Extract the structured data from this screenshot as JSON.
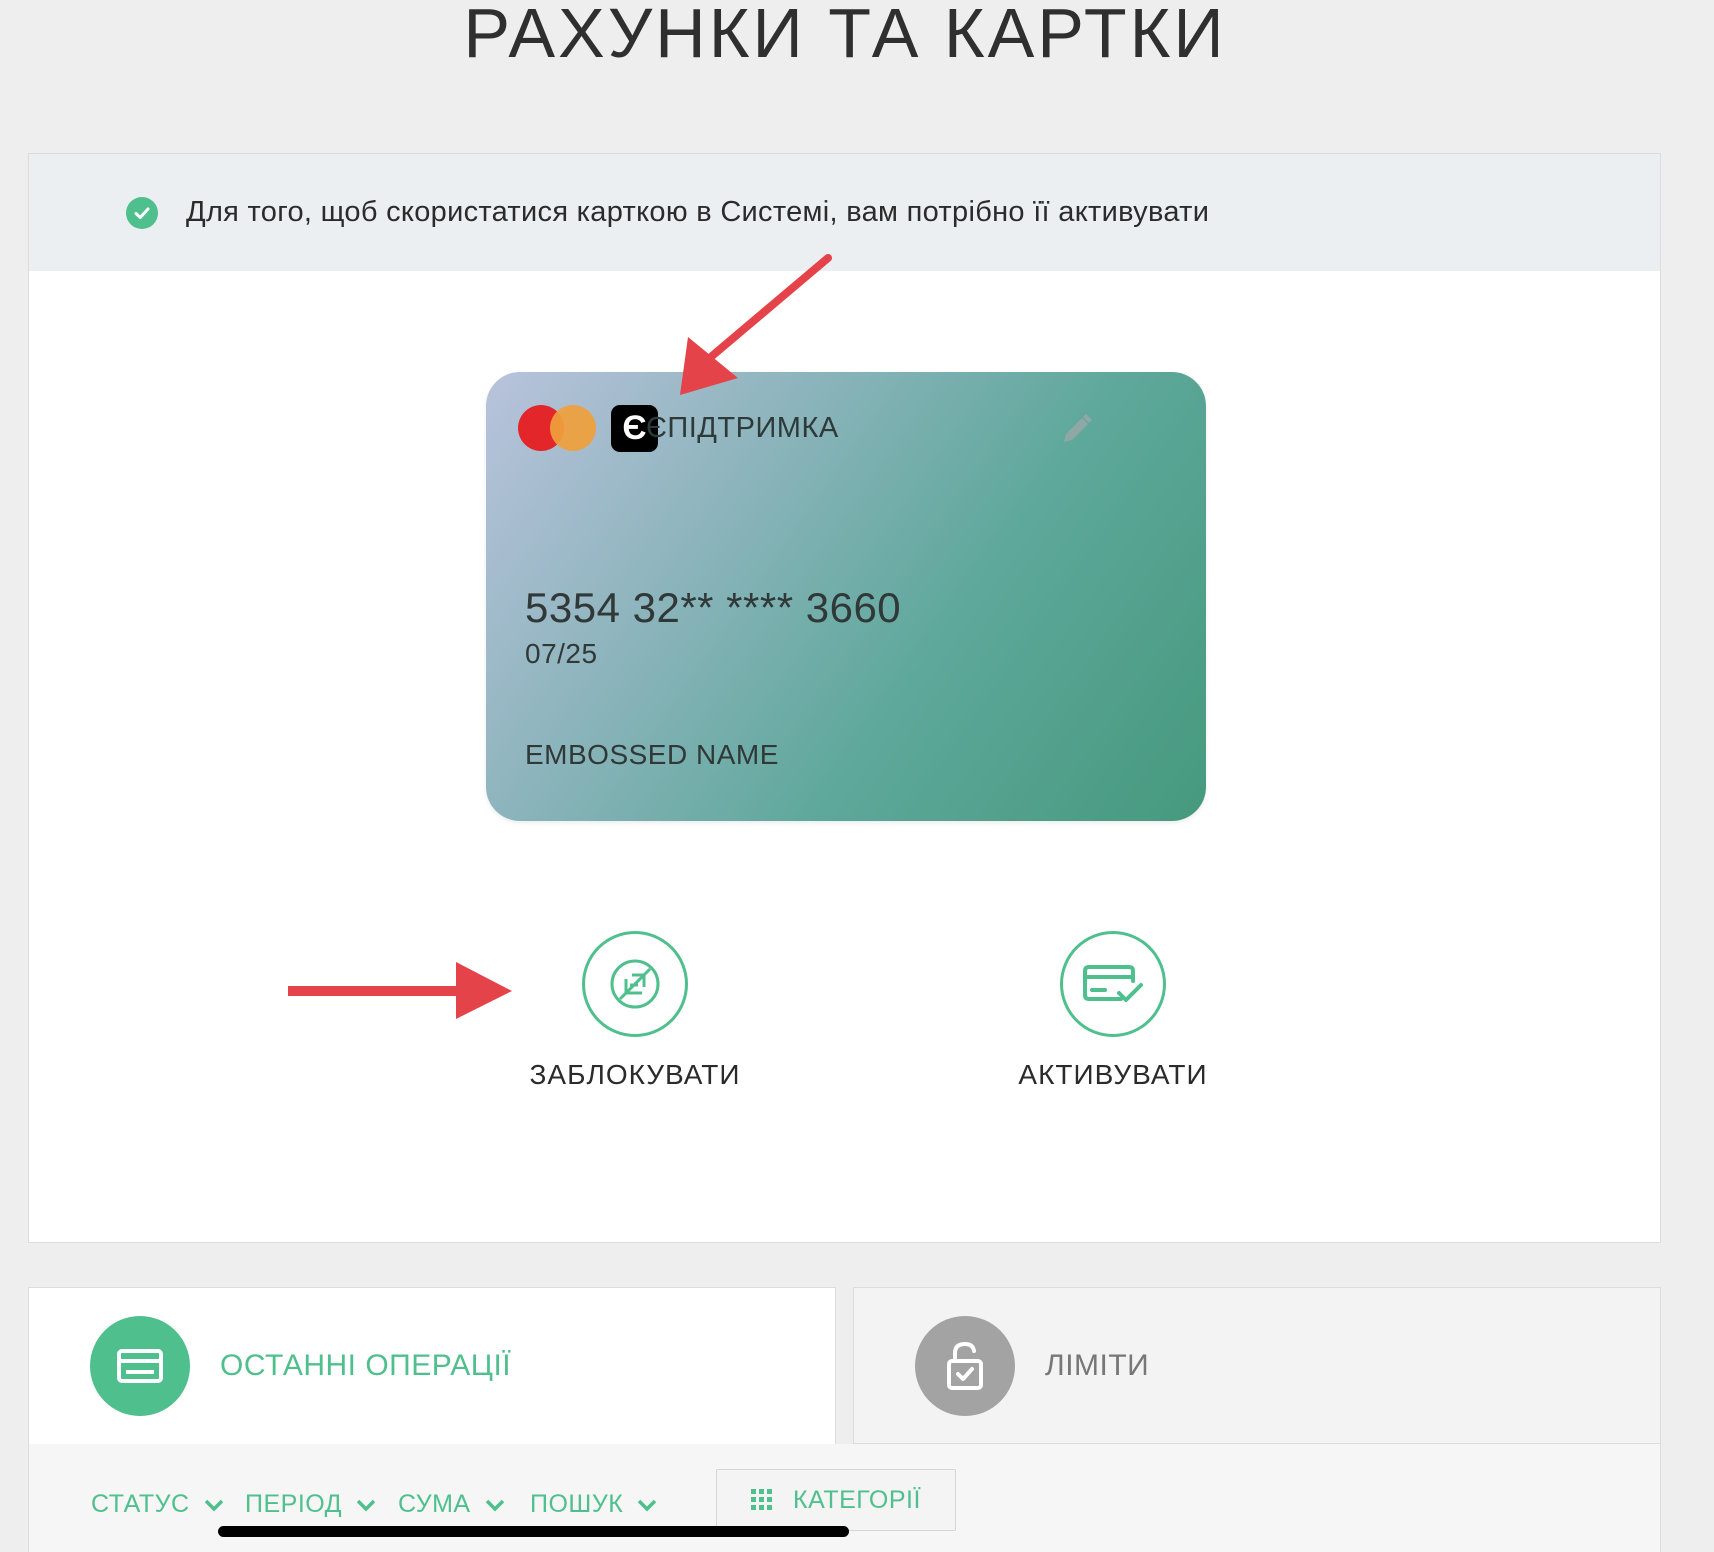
{
  "page": {
    "title": "РАХУНКИ ТА КАРТКИ"
  },
  "notice": {
    "text": "Для того, щоб скористатися карткою в Системі, вам потрібно її активувати"
  },
  "card": {
    "logo_letter": "Є",
    "name": "ЄПІДТРИМКА",
    "number": "5354 32** **** 3660",
    "expiry": "07/25",
    "holder": "EMBOSSED NAME",
    "edit_icon": "pencil-icon",
    "payment_system": "mastercard-logo"
  },
  "actions": {
    "block": {
      "label": "ЗАБЛОКУВАТИ",
      "icon": "card-blocked-icon"
    },
    "activate": {
      "label": "АКТИВУВАТИ",
      "icon": "card-check-icon"
    }
  },
  "tabs": [
    {
      "label": "ОСТАННІ ОПЕРАЦІЇ",
      "icon": "card-icon",
      "active": true
    },
    {
      "label": "ЛІМІТИ",
      "icon": "lock-check-icon",
      "active": false
    }
  ],
  "filters": {
    "status": "СТАТУС",
    "period": "ПЕРІОД",
    "sum": "СУМА",
    "search": "ПОШУК",
    "categories": "КАТЕГОРІЇ"
  },
  "colors": {
    "accent": "#4fc08d",
    "annotation_arrow": "#e5434a",
    "inactive_tab_icon": "#a3a3a3"
  }
}
